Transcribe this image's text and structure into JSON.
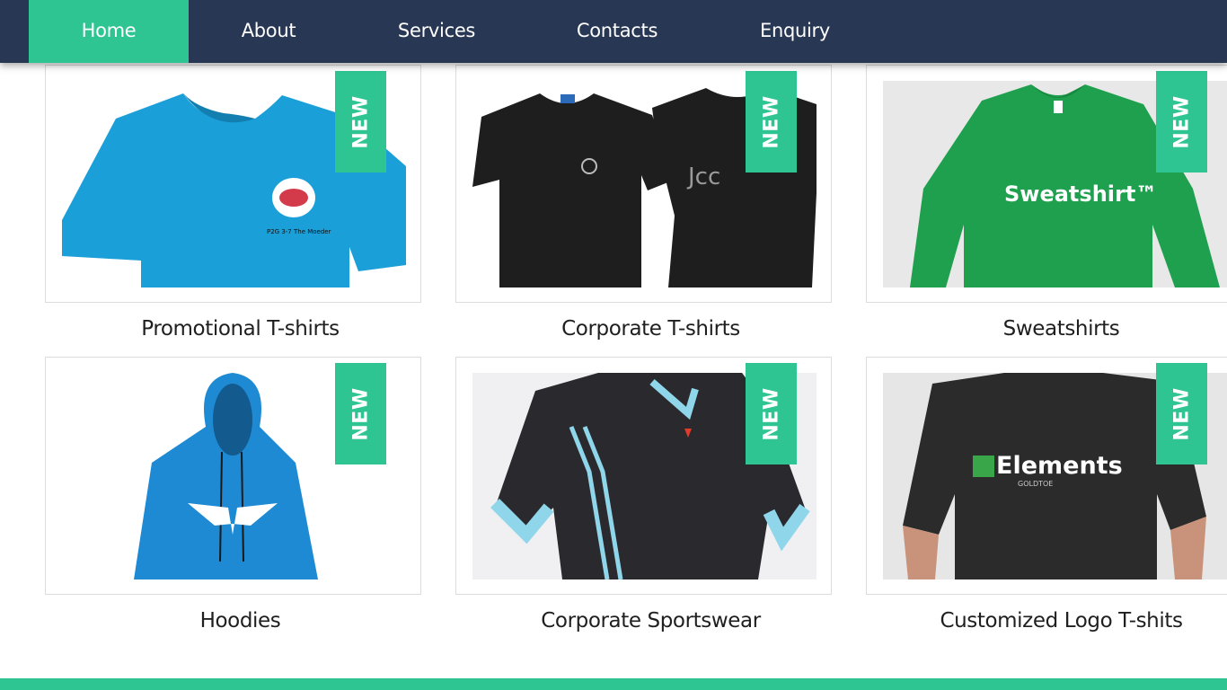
{
  "nav": {
    "items": [
      {
        "label": "Home",
        "active": true
      },
      {
        "label": "About"
      },
      {
        "label": "Services"
      },
      {
        "label": "Contacts"
      },
      {
        "label": "Enquiry"
      }
    ]
  },
  "products": [
    {
      "title": "Promotional T-shirts",
      "badge": "NEW",
      "image_icon": "blue-tshirt-icon",
      "color": "#1a9fd8",
      "print_text": "P2G 3-7 The Moeder"
    },
    {
      "title": "Corporate T-shirts",
      "badge": "NEW",
      "image_icon": "black-tshirts-icon",
      "color": "#1e1e1e",
      "print_text": "Jcc"
    },
    {
      "title": "Sweatshirts",
      "badge": "NEW",
      "image_icon": "green-sweatshirt-icon",
      "color": "#1fa04e",
      "print_text": "Sweatshirt™"
    },
    {
      "title": "Hoodies",
      "badge": "NEW",
      "image_icon": "blue-hoodie-icon",
      "color": "#1e8ad3"
    },
    {
      "title": "Corporate Sportswear",
      "badge": "NEW",
      "image_icon": "sports-jersey-icon",
      "color": "#2a2a2e"
    },
    {
      "title": "Customized Logo T-shits",
      "badge": "NEW",
      "image_icon": "logo-tshirt-icon",
      "color": "#2b2b2b",
      "print_text": "Elements",
      "print_subtext": "GOLDTOE"
    }
  ],
  "colors": {
    "nav_bg": "#283754",
    "accent": "#2ec593"
  }
}
